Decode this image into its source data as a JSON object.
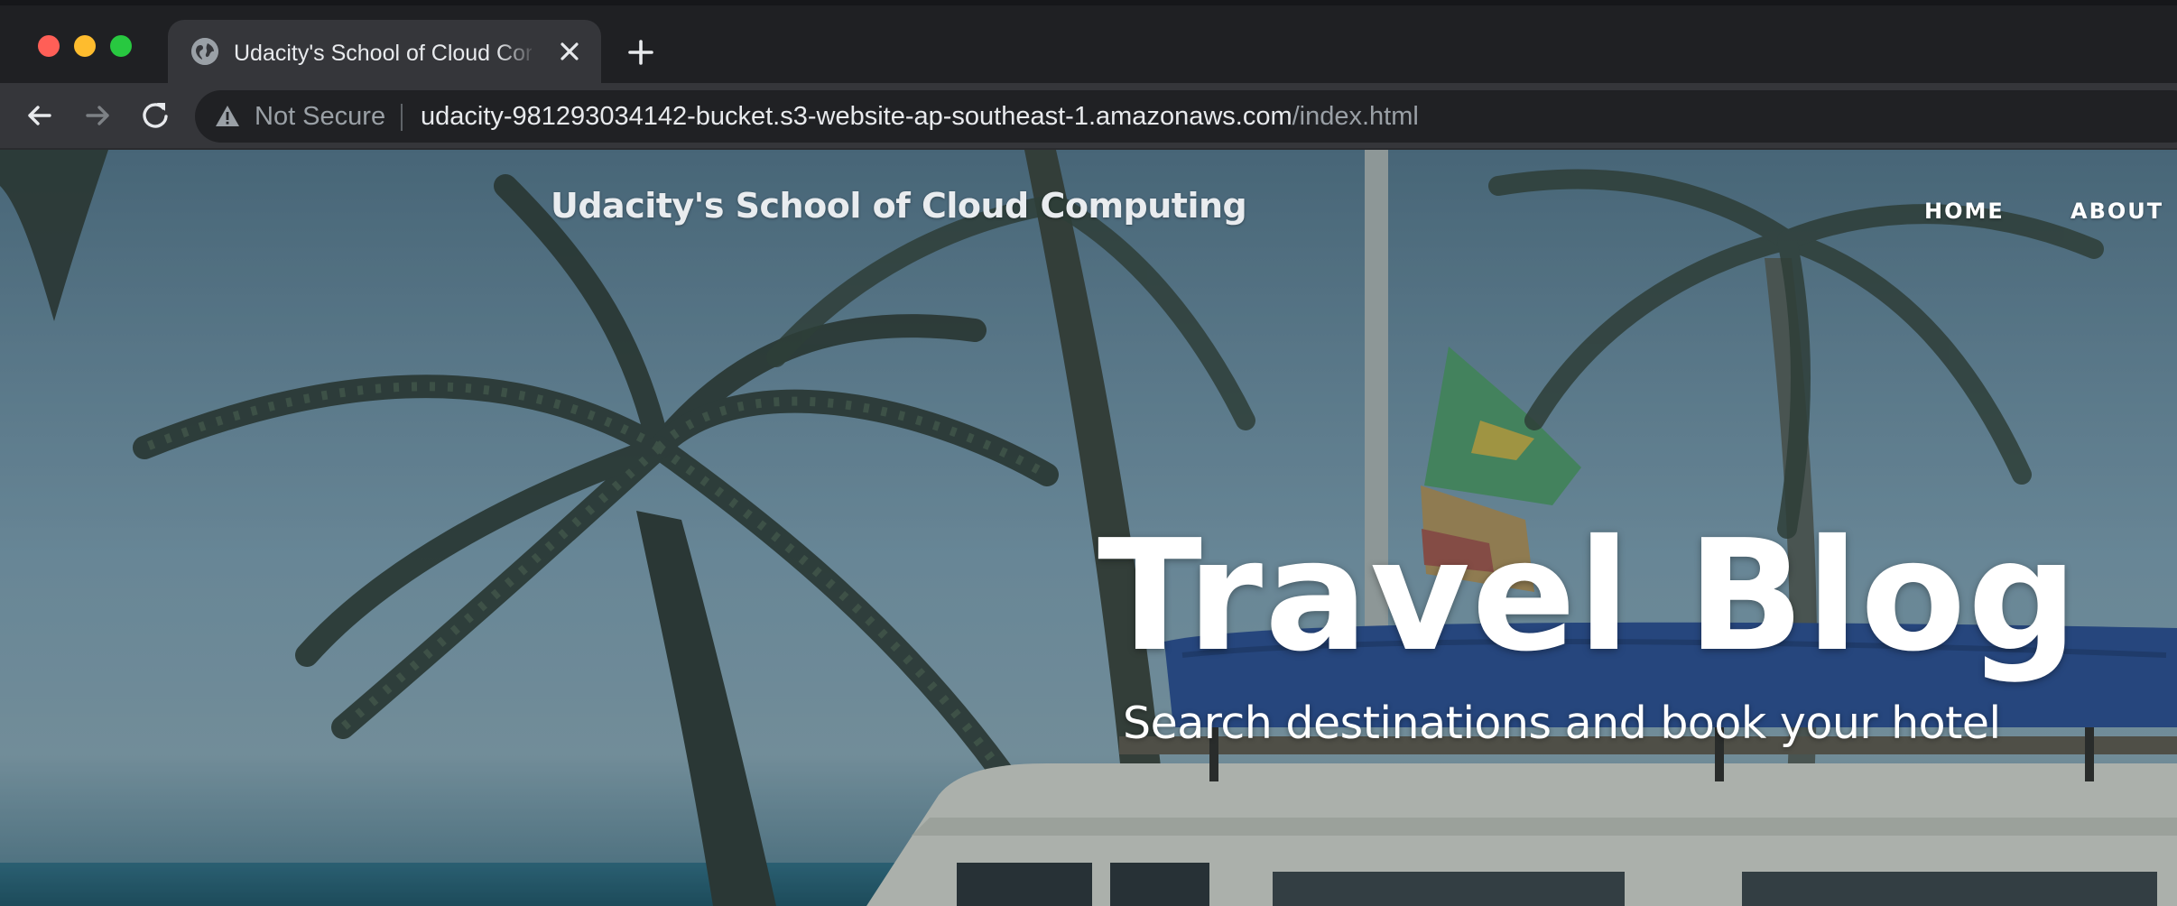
{
  "browser": {
    "window_controls": [
      "close",
      "minimize",
      "zoom"
    ],
    "tab": {
      "title": "Udacity's School of Cloud Computing",
      "favicon": "globe-icon",
      "close_icon": "close-icon"
    },
    "new_tab_icon": "plus-icon",
    "toolbar": {
      "back_icon": "arrow-left-icon",
      "forward_icon": "arrow-right-icon",
      "reload_icon": "reload-icon"
    },
    "omnibox": {
      "security_icon": "warning-triangle-icon",
      "security_label": "Not Secure",
      "url_host": "udacity-981293034142-bucket.s3-website-ap-southeast-1.amazonaws.com",
      "url_path": "/index.html"
    }
  },
  "site": {
    "title": "Udacity's School of Cloud Computing",
    "nav": [
      {
        "label": "HOME"
      },
      {
        "label": "ABOUT"
      }
    ],
    "hero": {
      "heading": "Travel Blog",
      "subheading": "Search destinations and book your hotel"
    }
  },
  "colors": {
    "tab_strip": "#1f2023",
    "toolbar": "#35363a",
    "omnibox": "#202124",
    "traffic_red": "#ff5f57",
    "traffic_yellow": "#febc2e",
    "traffic_green": "#28c840",
    "hero_overlay": "#54778b"
  }
}
